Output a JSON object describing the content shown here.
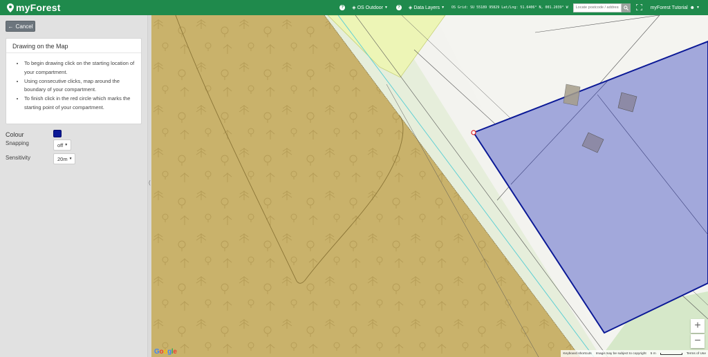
{
  "app": {
    "name": "myForest"
  },
  "topbar": {
    "help_glyph": "?",
    "basemap_label": "OS Outdoor",
    "data_layers_label": "Data Layers",
    "grid_readout": "OS Grid: SU 55189 95829  Lat/Lng: 51.6406° N, 001.2039° W",
    "search_placeholder": "Locate postcode / address",
    "user_label": "myForest Tutorial"
  },
  "sidebar": {
    "cancel_label": "Cancel",
    "card_title": "Drawing on the Map",
    "instructions": [
      "To begin drawing click on the starting location of your compartment.",
      "Using consecutive clicks, map around the boundary of your compartment.",
      "To finish click in the red circle which marks the starting point of your compartment."
    ],
    "colour_label": "Colour",
    "colour_value": "#0b1996",
    "snapping_label": "Snapping",
    "snapping_value": "off",
    "sensitivity_label": "Sensitivity",
    "sensitivity_value": "20m"
  },
  "map": {
    "zoom_in": "+",
    "zoom_out": "−",
    "google_logo": "Google",
    "attribution": {
      "shortcuts": "Keyboard shortcuts",
      "copyright": "Image may be subject to copyright",
      "scale": "5 m",
      "terms": "Terms of Use"
    }
  },
  "colors": {
    "brand_green": "#1f8a4c",
    "woodland": "#c9b26b",
    "polygon_fill": "#a2a8db",
    "polygon_stroke": "#0b1996"
  }
}
